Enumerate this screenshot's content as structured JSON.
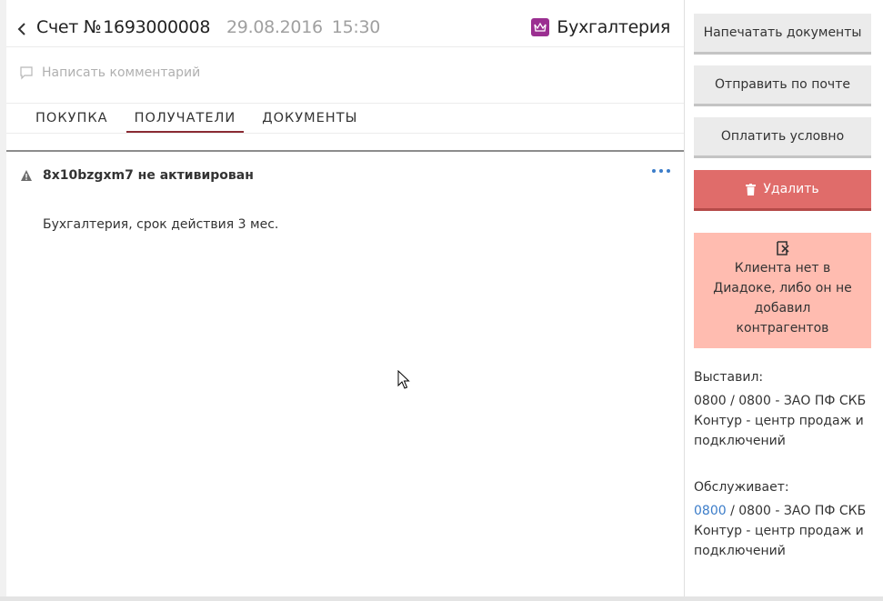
{
  "header": {
    "title_prefix": "Счет №",
    "invoice_number": "1693000008",
    "date": "29.08.2016",
    "time": "15:30",
    "product_name": "Бухгалтерия"
  },
  "comment": {
    "placeholder": "Написать комментарий"
  },
  "tabs": [
    {
      "label": "ПОКУПКА",
      "active": false
    },
    {
      "label": "ПОЛУЧАТЕЛИ",
      "active": true
    },
    {
      "label": "ДОКУМЕНТЫ",
      "active": false
    }
  ],
  "recipient": {
    "warning_title": "8x10bzgxm7 не активирован",
    "description": "Бухгалтерия, срок действия 3 мес."
  },
  "actions": {
    "print": "Напечатать документы",
    "email": "Отправить по почте",
    "pay_conditional": "Оплатить условно",
    "delete": "Удалить"
  },
  "notice": {
    "text": "Клиента нет в Диадоке, либо он не добавил контрагентов"
  },
  "issued_by": {
    "label": "Выставил:",
    "value": "0800 / 0800 - ЗАО ПФ СКБ Контур - центр продаж и подключений"
  },
  "served_by": {
    "label": "Обслуживает:",
    "link": "0800",
    "value_rest": " / 0800 - ЗАО ПФ СКБ Контур - центр продаж и подключений"
  },
  "colors": {
    "accent_tab": "#8a2b33",
    "delete_button": "#e06c6a",
    "notice_bg": "#ffbcb0",
    "link": "#3c7dc9",
    "product_icon": "#9b2f91"
  }
}
